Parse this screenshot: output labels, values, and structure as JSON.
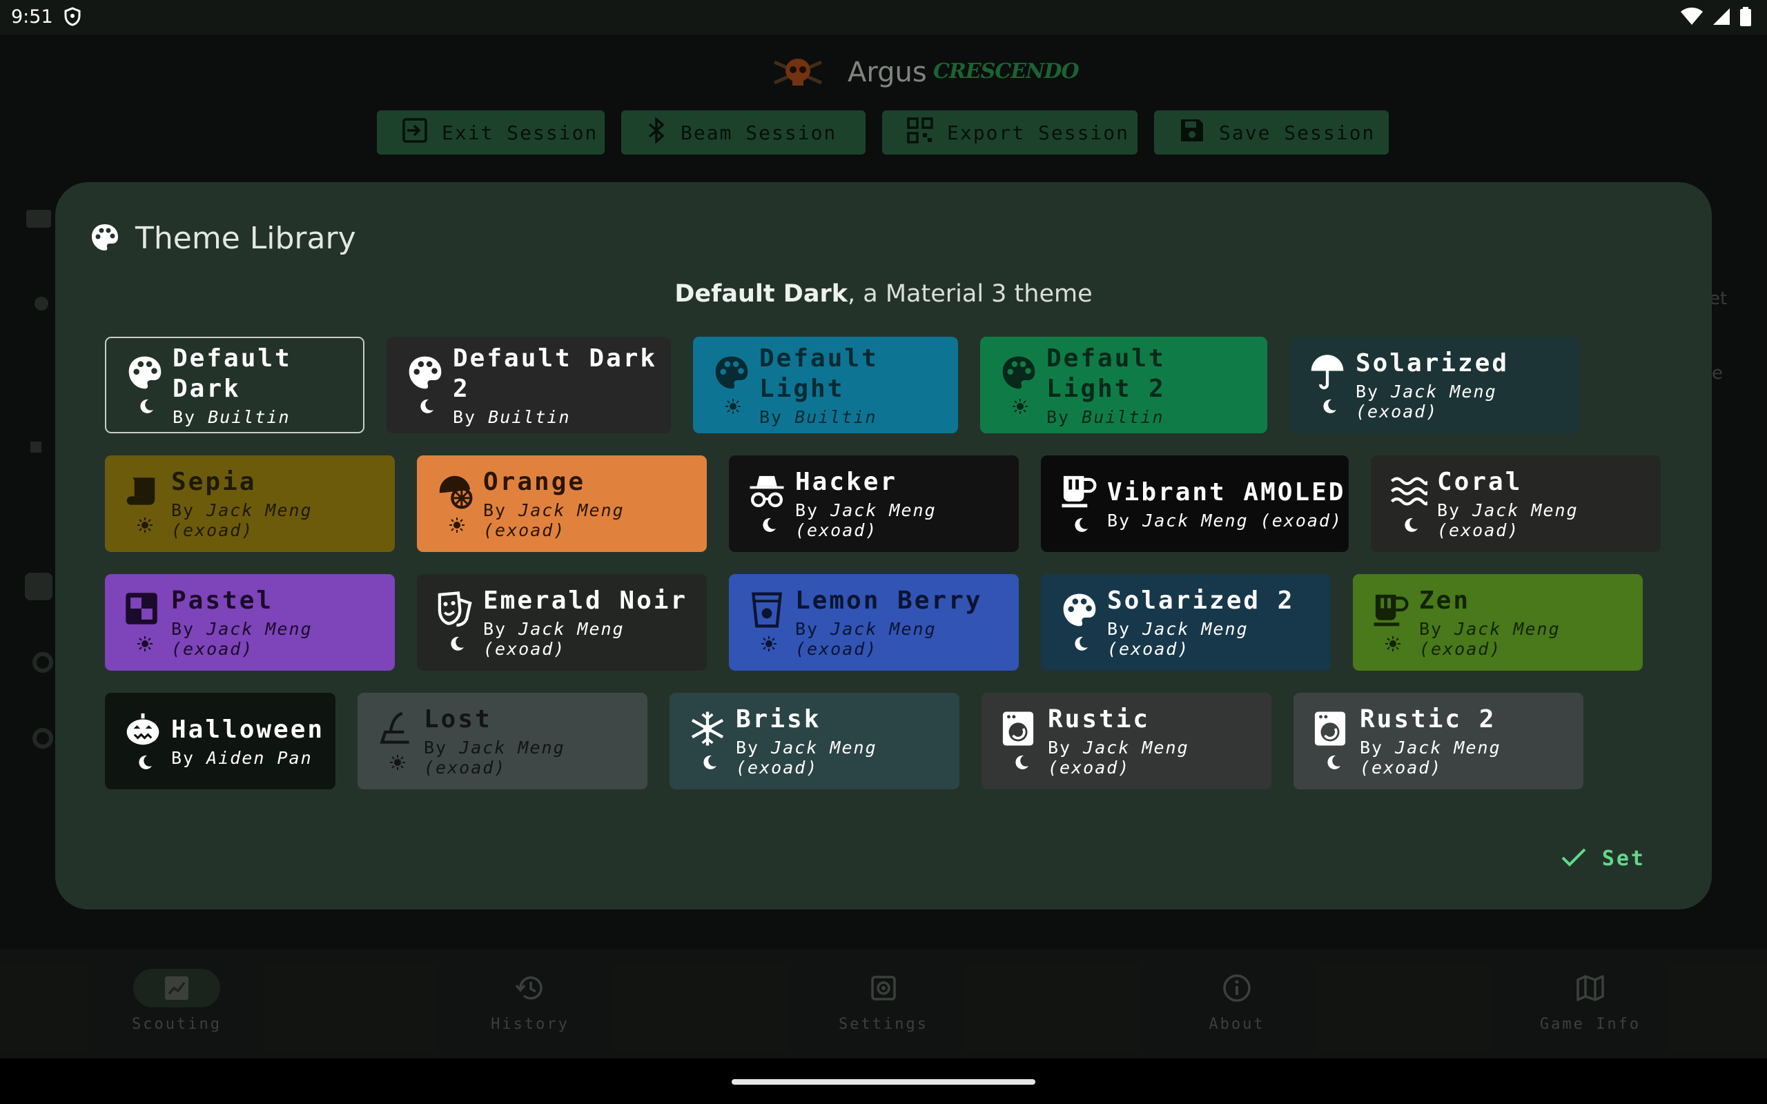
{
  "status_bar": {
    "time": "9:51"
  },
  "app": {
    "title": "Argus",
    "brand": "CRESCENDO"
  },
  "session_buttons": [
    {
      "label": "Exit Session",
      "icon": "exit-icon"
    },
    {
      "label": "Beam Session",
      "icon": "bluetooth-icon"
    },
    {
      "label": "Export Session",
      "icon": "qr-code-icon"
    },
    {
      "label": "Save Session",
      "icon": "save-icon"
    }
  ],
  "dialog": {
    "title": "Theme Library",
    "subtitle_bold": "Default Dark",
    "subtitle_rest": ", a Material 3 theme",
    "set_label": "Set",
    "selected_theme": "Default Dark",
    "themes": [
      {
        "name": "Default Dark",
        "author": "Builtin",
        "mode": "dark",
        "icon": "palette-icon",
        "bg": "#24332a",
        "fg": "#ffffff",
        "selected": true
      },
      {
        "name": "Default Dark 2",
        "author": "Builtin",
        "mode": "dark",
        "icon": "palette-icon",
        "bg": "#262726",
        "fg": "#ffffff"
      },
      {
        "name": "Default Light",
        "author": "Builtin",
        "mode": "light",
        "icon": "palette-icon",
        "bg": "#0d7593",
        "fg": "#0a2a33"
      },
      {
        "name": "Default Light 2",
        "author": "Builtin",
        "mode": "light",
        "icon": "palette-icon",
        "bg": "#0f7c47",
        "fg": "#07281a"
      },
      {
        "name": "Solarized",
        "author": "Jack Meng (exoad)",
        "mode": "dark",
        "icon": "umbrella-icon",
        "bg": "#1d3436",
        "fg": "#ffffff"
      },
      {
        "name": "Sepia",
        "author": "Jack Meng (exoad)",
        "mode": "light",
        "icon": "scroll-icon",
        "bg": "#6d5b0c",
        "fg": "#1e1a05"
      },
      {
        "name": "Orange",
        "author": "Jack Meng (exoad)",
        "mode": "light",
        "icon": "orange-icon",
        "bg": "#e0823e",
        "fg": "#2a1606"
      },
      {
        "name": "Hacker",
        "author": "Jack Meng (exoad)",
        "mode": "dark",
        "icon": "incognito-icon",
        "bg": "#121212",
        "fg": "#ffffff"
      },
      {
        "name": "Vibrant AMOLED",
        "author": "Jack Meng (exoad)",
        "mode": "dark",
        "icon": "mug-icon",
        "bg": "#0b0b0b",
        "fg": "#ffffff"
      },
      {
        "name": "Coral",
        "author": "Jack Meng (exoad)",
        "mode": "dark",
        "icon": "waves-icon",
        "bg": "#262625",
        "fg": "#ffffff"
      },
      {
        "name": "Pastel",
        "author": "Jack Meng (exoad)",
        "mode": "light",
        "icon": "shapes-icon",
        "bg": "#7e44b9",
        "fg": "#1a0b2a"
      },
      {
        "name": "Emerald Noir",
        "author": "Jack Meng (exoad)",
        "mode": "dark",
        "icon": "masks-icon",
        "bg": "#232623",
        "fg": "#ffffff"
      },
      {
        "name": "Lemon Berry",
        "author": "Jack Meng (exoad)",
        "mode": "light",
        "icon": "cup-icon",
        "bg": "#3154b5",
        "fg": "#0b1430"
      },
      {
        "name": "Solarized 2",
        "author": "Jack Meng (exoad)",
        "mode": "dark",
        "icon": "palette-icon",
        "bg": "#17384a",
        "fg": "#ffffff"
      },
      {
        "name": "Zen",
        "author": "Jack Meng (exoad)",
        "mode": "light",
        "icon": "mug-icon",
        "bg": "#49791a",
        "fg": "#142305"
      },
      {
        "name": "Halloween",
        "author": "Aiden Pan",
        "mode": "dark",
        "icon": "pumpkin-icon",
        "bg": "#0e1410",
        "fg": "#ffffff"
      },
      {
        "name": "Lost",
        "author": "Jack Meng (exoad)",
        "mode": "light",
        "icon": "witch-hat-icon",
        "bg": "#3f4847",
        "fg": "#111514"
      },
      {
        "name": "Brisk",
        "author": "Jack Meng (exoad)",
        "mode": "dark",
        "icon": "snowflake-icon",
        "bg": "#2b4445",
        "fg": "#ffffff"
      },
      {
        "name": "Rustic",
        "author": "Jack Meng (exoad)",
        "mode": "dark",
        "icon": "washer-icon",
        "bg": "#343635",
        "fg": "#ffffff"
      },
      {
        "name": "Rustic 2",
        "author": "Jack Meng (exoad)",
        "mode": "dark",
        "icon": "washer-icon",
        "bg": "#3d4342",
        "fg": "#ffffff"
      }
    ]
  },
  "bottom_nav": [
    {
      "label": "Scouting",
      "icon": "chart-icon",
      "active": true
    },
    {
      "label": "History",
      "icon": "history-icon"
    },
    {
      "label": "Settings",
      "icon": "settings-icon"
    },
    {
      "label": "About",
      "icon": "info-icon"
    },
    {
      "label": "Game Info",
      "icon": "map-icon"
    }
  ],
  "background_hints": {
    "right_text_1": "et",
    "right_text_2": "e"
  }
}
